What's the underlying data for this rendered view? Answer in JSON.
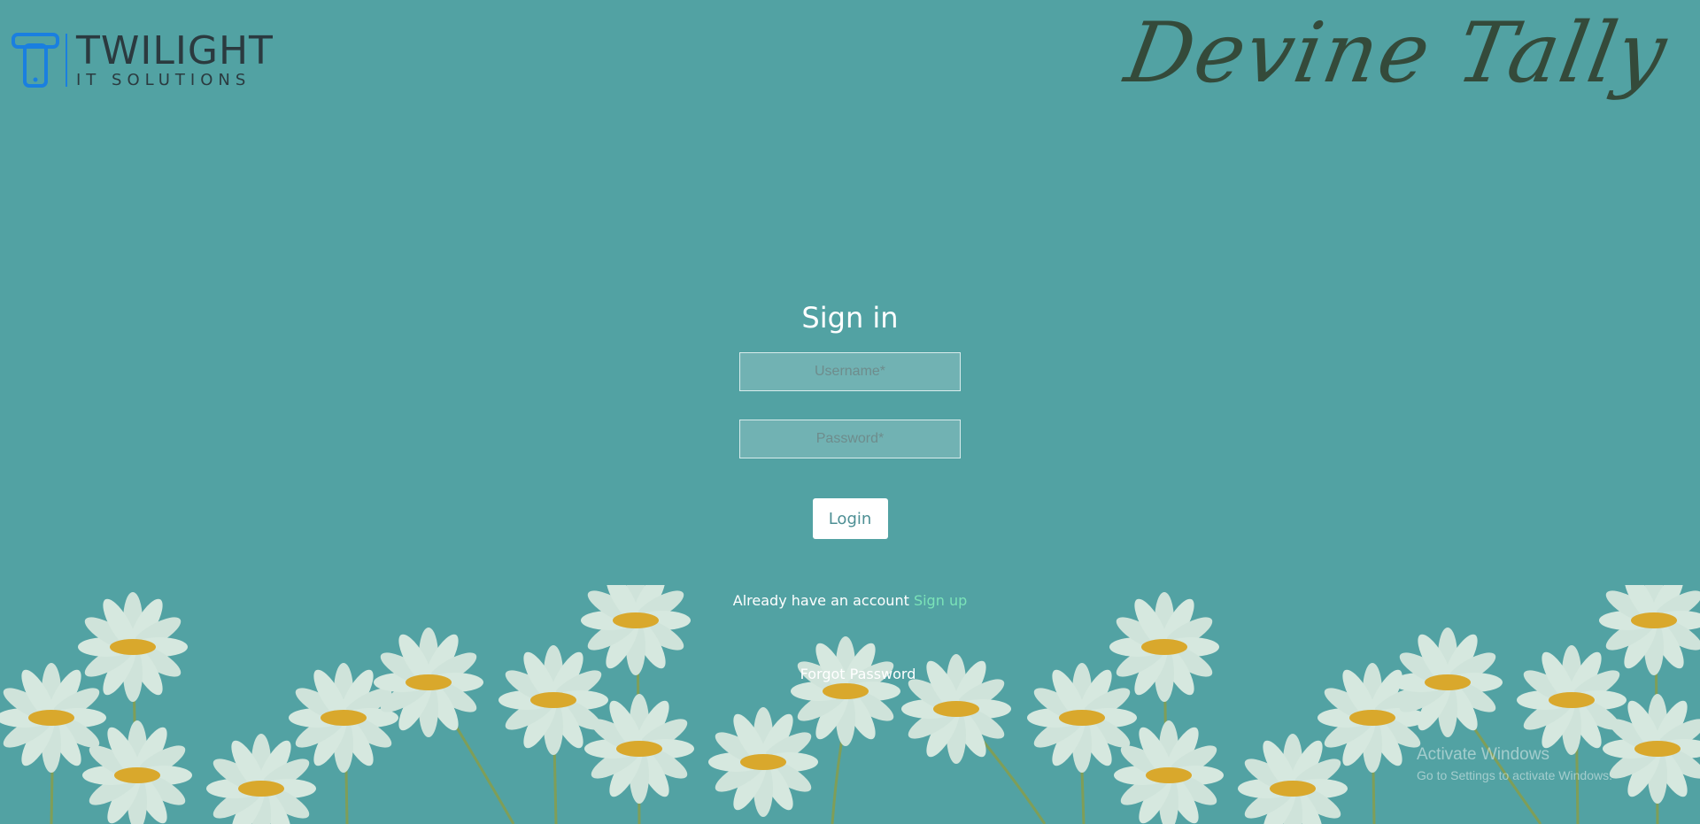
{
  "logo": {
    "name": "TWILIGHT",
    "tagline": "IT SOLUTIONS",
    "color": "#1a7fe0"
  },
  "brand": {
    "title": "Devine Tally"
  },
  "form": {
    "heading": "Sign in",
    "username_placeholder": "Username*",
    "password_placeholder": "Password*",
    "login_label": "Login",
    "account_prompt": "Already have an account",
    "signup_label": "Sign up",
    "forgot_label": "Forgot Password"
  },
  "watermark": {
    "title": "Activate Windows",
    "subtitle": "Go to Settings to activate Windows."
  },
  "colors": {
    "background": "#52a2a3",
    "accent_link": "#7be3b8",
    "button_text": "#4d8f94"
  }
}
